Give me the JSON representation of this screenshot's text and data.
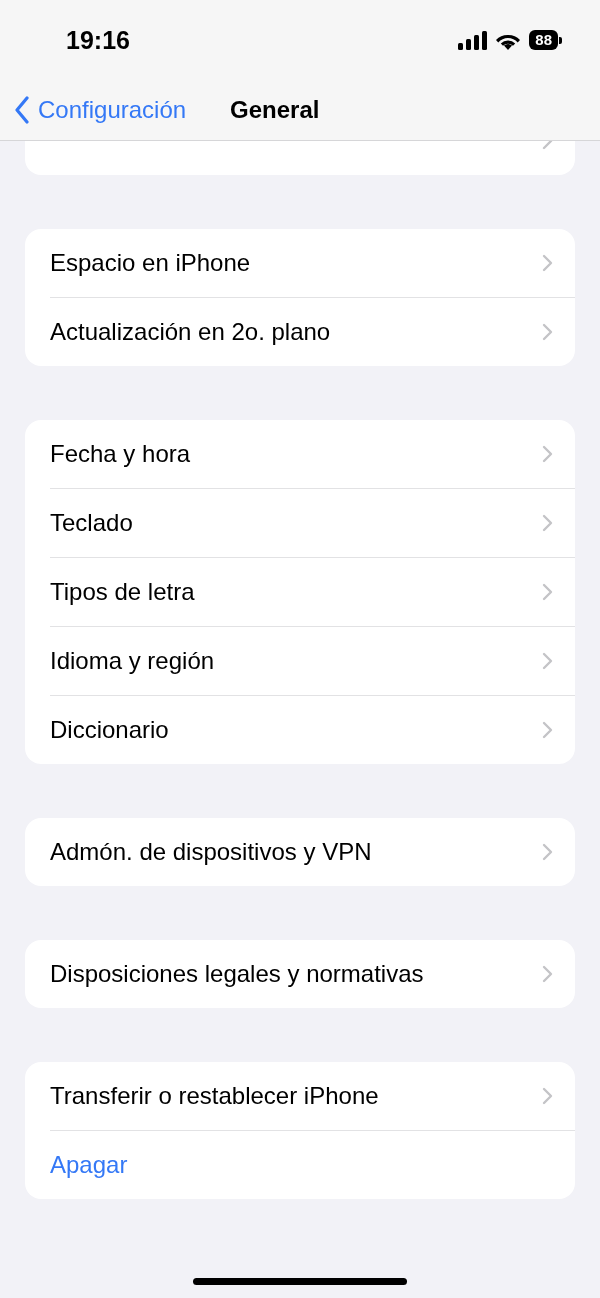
{
  "status_bar": {
    "time": "19:16",
    "battery": "88"
  },
  "nav_bar": {
    "back_label": "Configuración",
    "title": "General"
  },
  "groups": [
    {
      "items": [
        {
          "kind": "covered"
        }
      ]
    },
    {
      "items": [
        {
          "label": "Espacio en iPhone",
          "kind": "link"
        },
        {
          "label": "Actualización en 2o. plano",
          "kind": "link"
        }
      ]
    },
    {
      "items": [
        {
          "label": "Fecha y hora",
          "kind": "link"
        },
        {
          "label": "Teclado",
          "kind": "link"
        },
        {
          "label": "Tipos de letra",
          "kind": "link"
        },
        {
          "label": "Idioma y región",
          "kind": "link"
        },
        {
          "label": "Diccionario",
          "kind": "link"
        }
      ]
    },
    {
      "items": [
        {
          "label": "Admón. de dispositivos y VPN",
          "kind": "link"
        }
      ]
    },
    {
      "items": [
        {
          "label": "Disposiciones legales y normativas",
          "kind": "link"
        }
      ]
    },
    {
      "items": [
        {
          "label": "Transferir o restablecer iPhone",
          "kind": "link"
        },
        {
          "label": "Apagar",
          "kind": "action"
        }
      ]
    }
  ]
}
